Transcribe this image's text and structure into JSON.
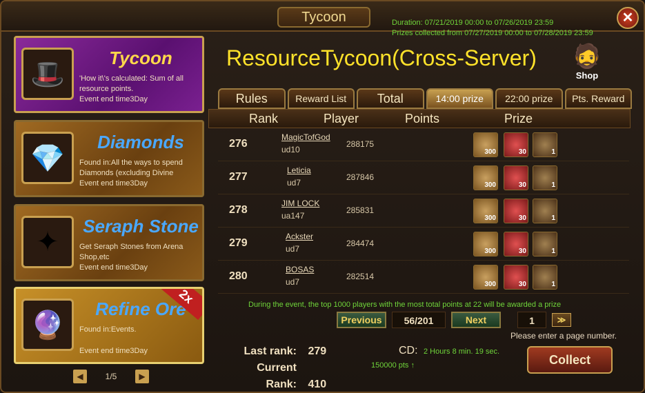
{
  "window": {
    "title": "Tycoon",
    "duration": "Duration: 07/21/2019 00:00 to 07/26/2019 23:59",
    "prizes_period": "Prizes collected from 07/27/2019 00:00 to 07/28/2019 23:59",
    "close_glyph": "✕"
  },
  "sidebar": {
    "cards": [
      {
        "name": "Tycoon",
        "desc": "'How it\\'s calculated: Sum of all resource points.",
        "end": "Event end time3Day",
        "icon": "tycoon-portrait-icon",
        "name_color": "#ffd84a"
      },
      {
        "name": "Diamonds",
        "desc": "Found in:All the ways to spend Diamonds (excluding Divine",
        "end": "Event end time3Day",
        "icon": "diamond-icon",
        "name_color": "#4aa8ff"
      },
      {
        "name": "Seraph Stone",
        "desc": "Get Seraph Stones from Arena Shop,etc",
        "end": "Event end time3Day",
        "icon": "seraph-stone-icon",
        "name_color": "#4aa8ff"
      },
      {
        "name": "Refine Ore",
        "desc": "Found in:Events.",
        "end": "Event end time3Day",
        "icon": "refine-ore-icon",
        "name_color": "#4aa8ff",
        "badge": "2x"
      }
    ],
    "pager": {
      "prev": "◀",
      "text": "1/5",
      "next": "▶"
    }
  },
  "main": {
    "title": "ResourceTycoon(Cross-Server)",
    "shop_label": "Shop",
    "tabs": [
      {
        "label": "Rules",
        "wide": true
      },
      {
        "label": "Reward List"
      },
      {
        "label": "Total",
        "wide": true
      },
      {
        "label": "14:00 prize",
        "selected": true
      },
      {
        "label": "22:00 prize"
      },
      {
        "label": "Pts. Reward"
      }
    ],
    "columns": [
      "Rank",
      "Player",
      "Points",
      "Prize"
    ],
    "rows": [
      {
        "rank": "276",
        "name": "MagicTofGod",
        "server": "ud10",
        "points": "288175",
        "prizes": [
          "300",
          "30",
          "1"
        ]
      },
      {
        "rank": "277",
        "name": "Leticia",
        "server": "ud7",
        "points": "287846",
        "prizes": [
          "300",
          "30",
          "1"
        ]
      },
      {
        "rank": "278",
        "name": "JIM LOCK",
        "server": "ua147",
        "points": "285831",
        "prizes": [
          "300",
          "30",
          "1"
        ]
      },
      {
        "rank": "279",
        "name": "Ackster",
        "server": "ud7",
        "points": "284474",
        "prizes": [
          "300",
          "30",
          "1"
        ]
      },
      {
        "rank": "280",
        "name": "BOSAS",
        "server": "ud7",
        "points": "282514",
        "prizes": [
          "300",
          "30",
          "1"
        ]
      }
    ],
    "notice": "During the event, the top 1000 players with the most total points at 22 will be awarded a prize",
    "pager": {
      "prev": "Previous",
      "page": "56/201",
      "next": "Next",
      "input": "1",
      "go": "≫"
    },
    "hint": "Please enter a page number.",
    "last_rank_label": "Last rank:",
    "last_rank": "279",
    "current_rank_label": "Current Rank:",
    "current_rank": "410",
    "cd_label": "CD:",
    "cd_value": "2 Hours 8 min. 19 sec.",
    "pts_value": "150000 pts ↑",
    "collect_label": "Collect"
  },
  "colors": {
    "accent_green": "#6fd43a",
    "title_yellow": "#ffe22a",
    "frame_gold": "#c9a050"
  }
}
